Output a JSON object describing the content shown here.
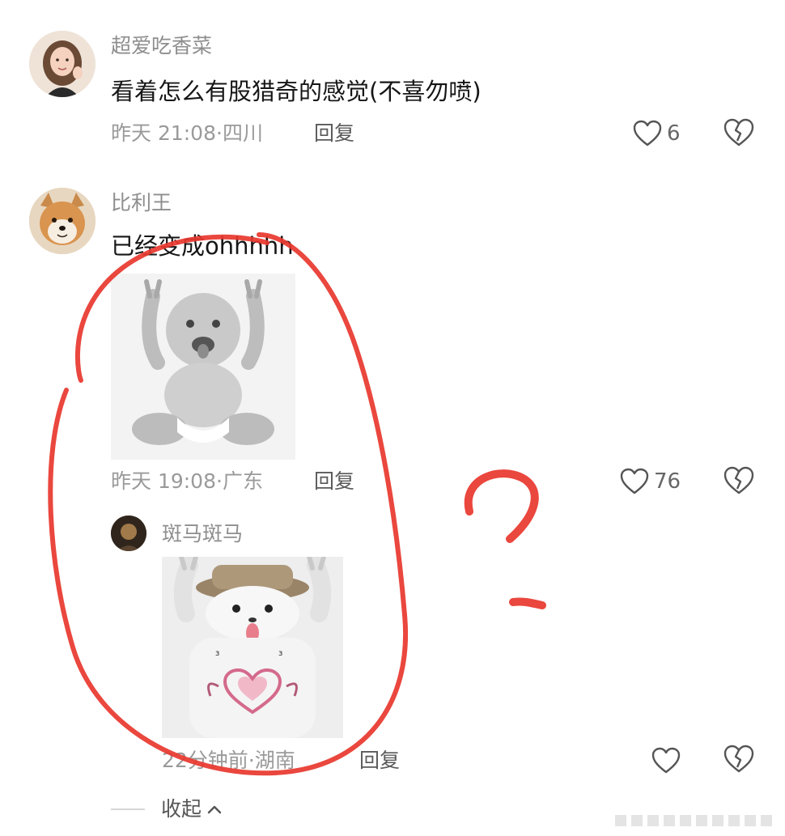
{
  "comments": [
    {
      "username": "超爱吃香菜",
      "text": "看着怎么有股猎奇的感觉(不喜勿喷)",
      "time": "昨天 21:08",
      "location": "四川",
      "reply_label": "回复",
      "likes": "6"
    },
    {
      "username": "比利王",
      "text": "已经变成ohhhhh",
      "time": "昨天 19:08",
      "location": "广东",
      "reply_label": "回复",
      "likes": "76"
    }
  ],
  "reply": {
    "username": "斑马斑马",
    "time": "22分钟前",
    "location": "湖南",
    "reply_label": "回复",
    "likes": ""
  },
  "collapse_label": "收起",
  "meta_separator": "·",
  "colors": {
    "annotation_red": "#e8372e",
    "text_dark": "#161616",
    "text_gray": "#9a9a9a",
    "icon_gray": "#555555"
  }
}
